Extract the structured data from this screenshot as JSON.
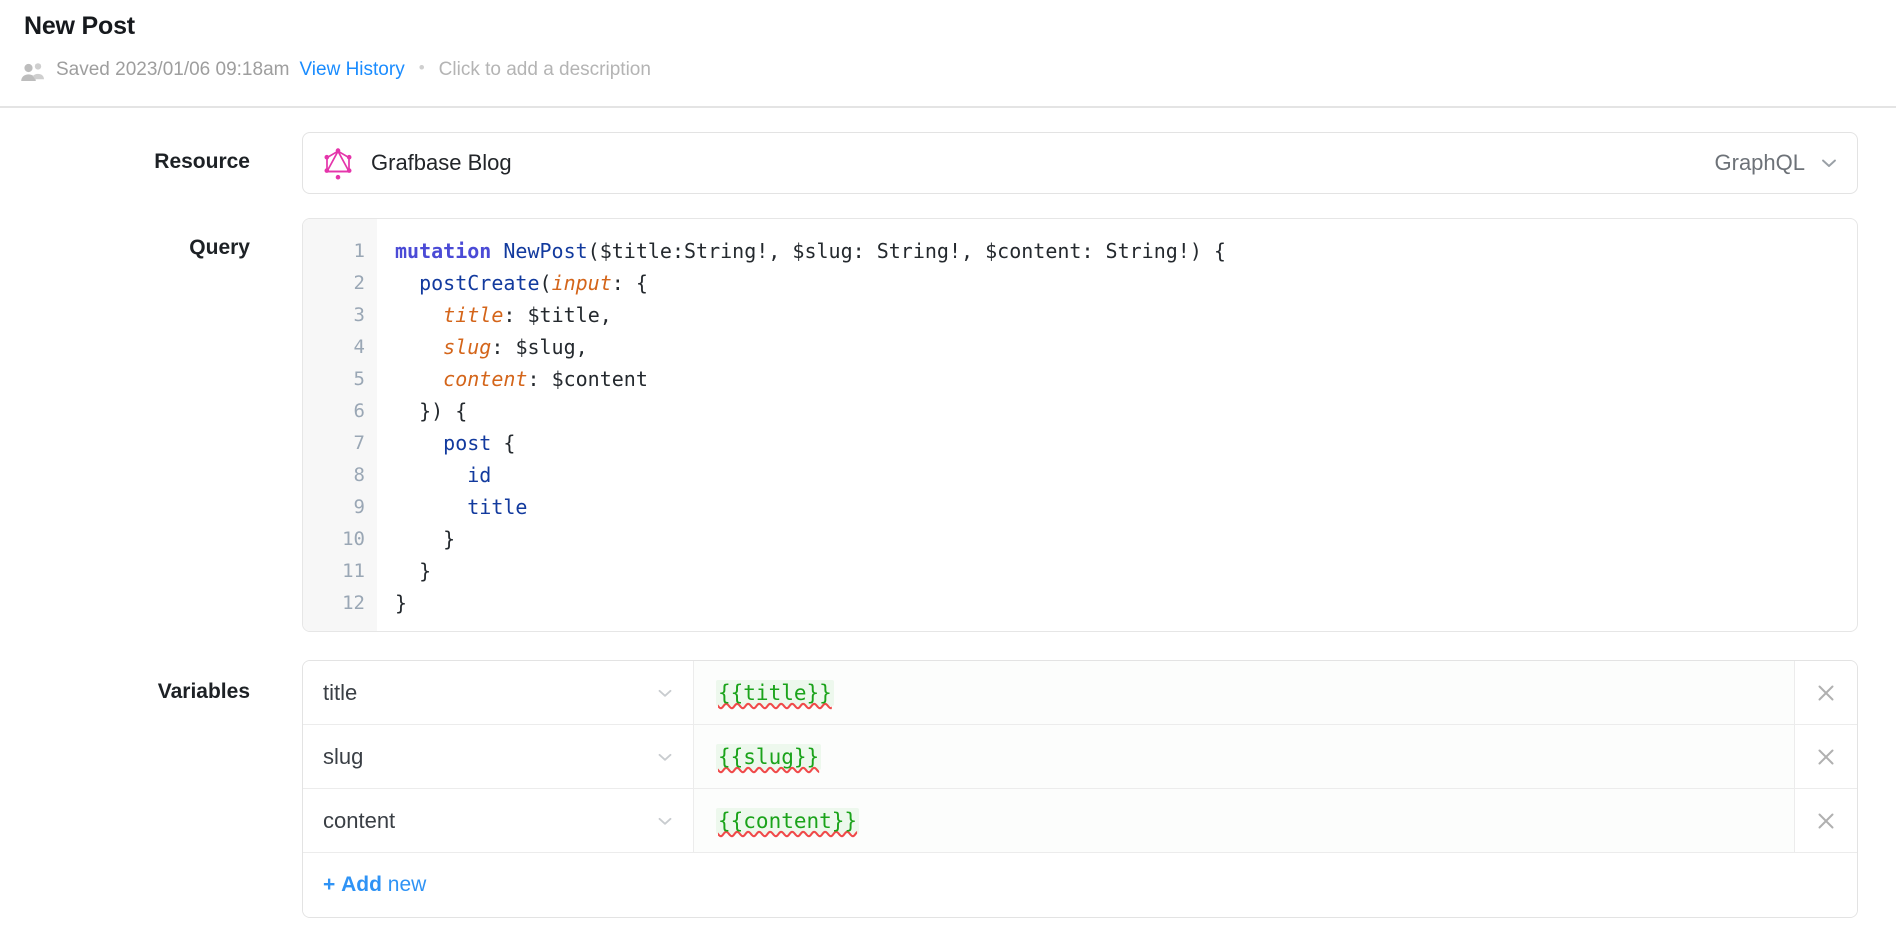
{
  "header": {
    "title": "New Post",
    "owner_icon": "users-icon",
    "saved_text": "Saved 2023/01/06 09:18am",
    "view_history_label": "View History",
    "separator": "•",
    "description_placeholder": "Click to add a description"
  },
  "labels": {
    "resource": "Resource",
    "query": "Query",
    "variables": "Variables"
  },
  "resource": {
    "icon": "graphql-logo-icon",
    "name": "Grafbase Blog",
    "kind": "GraphQL",
    "chevron": "chevron-down-icon"
  },
  "query": {
    "line_numbers": [
      "1",
      "2",
      "3",
      "4",
      "5",
      "6",
      "7",
      "8",
      "9",
      "10",
      "11",
      "12"
    ],
    "lines": [
      "mutation NewPost($title:String!, $slug: String!, $content: String!) {",
      "  postCreate(input: {",
      "    title: $title,",
      "    slug: $slug,",
      "    content: $content",
      "  }) {",
      "    post {",
      "      id",
      "      title",
      "    }",
      "  }",
      "}"
    ]
  },
  "variables": {
    "rows": [
      {
        "key": "title",
        "value": "{{title}}"
      },
      {
        "key": "slug",
        "value": "{{slug}}"
      },
      {
        "key": "content",
        "value": "{{content}}"
      }
    ],
    "add_new_plus": "+",
    "add_new_bold": "Add",
    "add_new_rest": "new",
    "delete_icon": "close-icon",
    "key_chevron": "chevron-down-icon"
  },
  "colors": {
    "link_blue": "#1a8cff",
    "accent_blue": "#2f93f5",
    "graphql_pink": "#e535ab",
    "keyword_purple": "#4b4bd6",
    "field_blue": "#123a9e",
    "arg_orange": "#d4651a",
    "value_green": "#1aa31a",
    "value_green_bg": "#edf8ed",
    "muted_gray": "#9b9b9b",
    "gutter_bg": "#f7f7f7",
    "line_number": "#9aa7b5",
    "border": "#e3e3e3"
  }
}
